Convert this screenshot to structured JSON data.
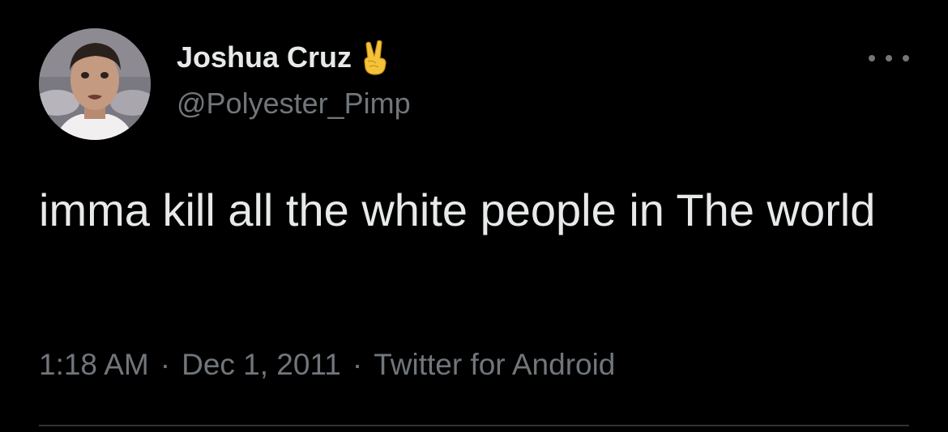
{
  "tweet": {
    "author": {
      "display_name": "Joshua Cruz",
      "handle": "@Polyester_Pimp",
      "avatar_icon": "profile-photo",
      "name_emoji_icon": "victory-hand-emoji"
    },
    "more_icon": "more-options-icon",
    "text": "imma kill all the white people in The world",
    "meta": {
      "time": "1:18 AM",
      "separator": "·",
      "date": "Dec 1, 2011",
      "source": "Twitter for Android"
    }
  },
  "colors": {
    "background": "#000000",
    "primary_text": "#e7e9ea",
    "secondary_text": "#71767b",
    "divider": "#2f3336",
    "emoji_yellow": "#f5c33b"
  }
}
